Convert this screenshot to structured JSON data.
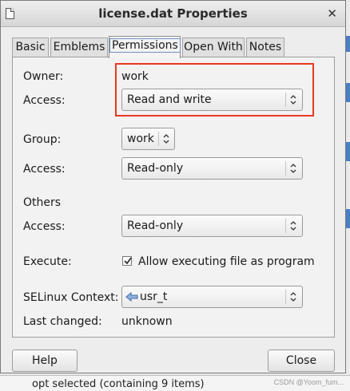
{
  "window": {
    "title": "license.dat Properties"
  },
  "tabs": [
    {
      "label": "Basic",
      "active": false
    },
    {
      "label": "Emblems",
      "active": false
    },
    {
      "label": "Permissions",
      "active": true
    },
    {
      "label": "Open With",
      "active": false
    },
    {
      "label": "Notes",
      "active": false
    }
  ],
  "permissions": {
    "owner_label": "Owner:",
    "owner_value": "work",
    "owner_access_label": "Access:",
    "owner_access_value": "Read and write",
    "group_label": "Group:",
    "group_value": "work",
    "group_access_label": "Access:",
    "group_access_value": "Read-only",
    "others_label": "Others",
    "others_access_label": "Access:",
    "others_access_value": "Read-only",
    "execute_label": "Execute:",
    "execute_checkbox_label": "Allow executing file as program",
    "execute_checked": true,
    "selinux_label": "SELinux Context:",
    "selinux_value": "usr_t",
    "last_changed_label": "Last changed:",
    "last_changed_value": "unknown"
  },
  "buttons": {
    "help": "Help",
    "close": "Close"
  },
  "background": {
    "status_text": "opt  selected (containing 9 items)",
    "watermark": "CSDN @Yoom_fum..."
  },
  "colors": {
    "highlight": "#e8391f",
    "active_tab_focus": "#6d92c2",
    "accent_blue": "#4a7fc0"
  },
  "icons": {
    "close": "close-icon",
    "dropdown": "updown-arrows-icon",
    "selinux": "arrow-left-icon",
    "title": "document-icon"
  }
}
